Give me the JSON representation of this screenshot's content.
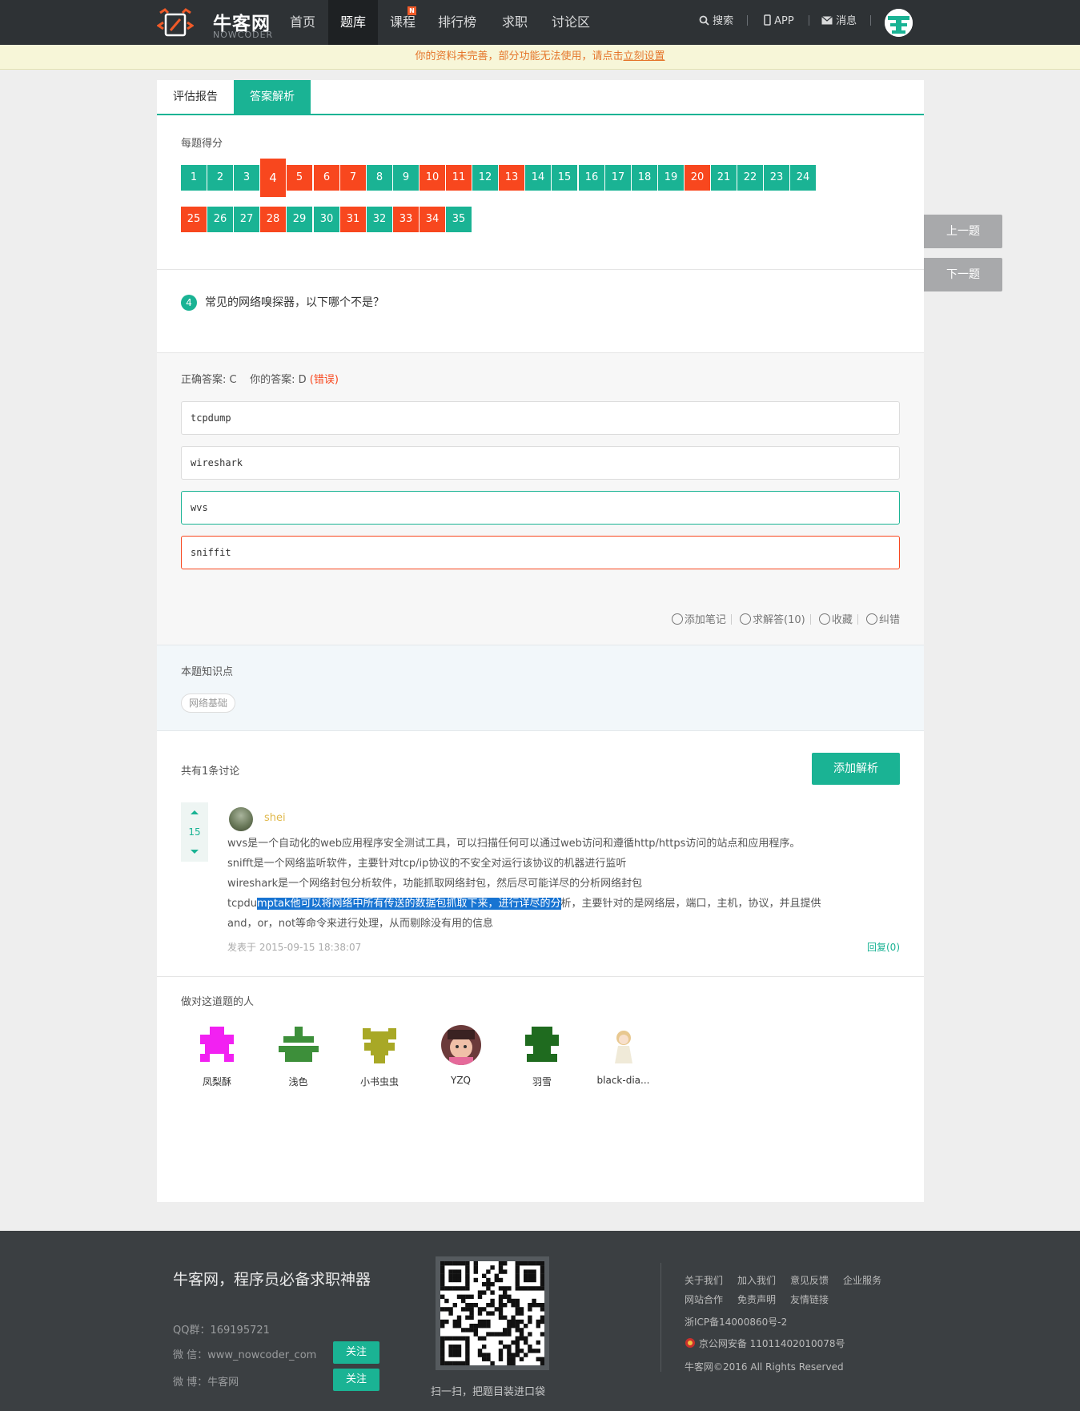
{
  "nav": {
    "logo_cn": "牛客网",
    "logo_en": "NOWCODER",
    "links": [
      "首页",
      "题库",
      "课程",
      "排行榜",
      "求职",
      "讨论区"
    ],
    "course_badge": "N",
    "search": "搜索",
    "app": "APP",
    "message": "消息"
  },
  "notice": {
    "text": "你的资料未完善，部分功能无法使用，请点击",
    "link": "立刻设置"
  },
  "tabs": [
    "评估报告",
    "答案解析"
  ],
  "score_title": "每题得分",
  "questions": [
    {
      "n": "1",
      "s": "right"
    },
    {
      "n": "2",
      "s": "right"
    },
    {
      "n": "3",
      "s": "right"
    },
    {
      "n": "4",
      "s": "cur"
    },
    {
      "n": "5",
      "s": "wrong"
    },
    {
      "n": "6",
      "s": "wrong"
    },
    {
      "n": "7",
      "s": "wrong"
    },
    {
      "n": "8",
      "s": "right"
    },
    {
      "n": "9",
      "s": "right"
    },
    {
      "n": "10",
      "s": "wrong"
    },
    {
      "n": "11",
      "s": "wrong"
    },
    {
      "n": "12",
      "s": "right"
    },
    {
      "n": "13",
      "s": "wrong"
    },
    {
      "n": "14",
      "s": "right"
    },
    {
      "n": "15",
      "s": "right"
    },
    {
      "n": "16",
      "s": "right"
    },
    {
      "n": "17",
      "s": "right"
    },
    {
      "n": "18",
      "s": "right"
    },
    {
      "n": "19",
      "s": "right"
    },
    {
      "n": "20",
      "s": "wrong"
    },
    {
      "n": "21",
      "s": "right"
    },
    {
      "n": "22",
      "s": "right"
    },
    {
      "n": "23",
      "s": "right"
    },
    {
      "n": "24",
      "s": "right"
    },
    {
      "n": "25",
      "s": "wrong"
    },
    {
      "n": "26",
      "s": "right"
    },
    {
      "n": "27",
      "s": "right"
    },
    {
      "n": "28",
      "s": "wrong"
    },
    {
      "n": "29",
      "s": "right"
    },
    {
      "n": "30",
      "s": "right"
    },
    {
      "n": "31",
      "s": "wrong"
    },
    {
      "n": "32",
      "s": "right"
    },
    {
      "n": "33",
      "s": "wrong"
    },
    {
      "n": "34",
      "s": "wrong"
    },
    {
      "n": "35",
      "s": "right"
    }
  ],
  "question": {
    "number": "4",
    "text": "常见的网络嗅探器，以下哪个不是？",
    "correct_label": "正确答案: C",
    "yours_label": "你的答案: D",
    "wrong_mark": "(错误)",
    "options": [
      "tcpdump",
      "wireshark",
      "wvs",
      "sniffit"
    ]
  },
  "tools": {
    "note": "添加笔记",
    "ask": "求解答(10)",
    "fav": "收藏",
    "fix": "纠错"
  },
  "knowledge": {
    "title": "本题知识点",
    "tag": "网络基础"
  },
  "discussion": {
    "count": "共有1条讨论",
    "add_button": "添加解析",
    "votes": "15",
    "user": "shei",
    "lines": [
      "wvs是一个自动化的web应用程序安全测试工具，可以扫描任何可以通过web访问和遵循http/https访问的站点和应用程序。",
      "snifft是一个网络监听软件，主要针对tcp/ip协议的不安全对运行该协议的机器进行监听",
      "wireshark是一个网络封包分析软件，功能抓取网络封包，然后尽可能详尽的分析网络封包"
    ],
    "line4_a": "tcpdu",
    "line4_hl": "mptak他可以将网络中所有传送的数据包抓取下来，进行详尽的分",
    "line4_b": "析，主要针对的是网络层，端口，主机，协议，并且提供",
    "line5": "and，or，not等命令来进行处理，从而剔除没有用的信息",
    "time": "发表于 2015-09-15 18:38:07",
    "reply": "回复(0)"
  },
  "solvers": {
    "title": "做对这道题的人",
    "users": [
      {
        "name": "凤梨酥",
        "color": "#f221f2"
      },
      {
        "name": "浅色",
        "color": "#3d8f3a"
      },
      {
        "name": "小书虫虫",
        "color": "#a8a826"
      },
      {
        "name": "YZQ",
        "color": "#c98a7a"
      },
      {
        "name": "羽雪",
        "color": "#1f6b1f"
      },
      {
        "name": "black-dia...",
        "color": "#e8d6b0"
      }
    ]
  },
  "side": {
    "prev": "上一题",
    "next": "下一题"
  },
  "footer": {
    "slogan": "牛客网，程序员必备求职神器",
    "qq": "QQ群：169195721",
    "wechat": "微 信：www_nowcoder_com",
    "weibo": "微 博：牛客网",
    "follow": "关注",
    "qr_caption": "扫一扫，把题目装进口袋",
    "links": [
      "关于我们",
      "加入我们",
      "意见反馈",
      "企业服务",
      "网站合作",
      "免责声明",
      "友情链接"
    ],
    "icp": "浙ICP备14000860号-2",
    "police": "京公网安备 11011402010078号",
    "copyright": "牛客网©2016 All Rights Reserved"
  },
  "colors": {
    "accent": "#1ab394",
    "wrong": "#f8471e",
    "nav_bg": "#2e3235",
    "footer_bg": "#3b3f42"
  }
}
